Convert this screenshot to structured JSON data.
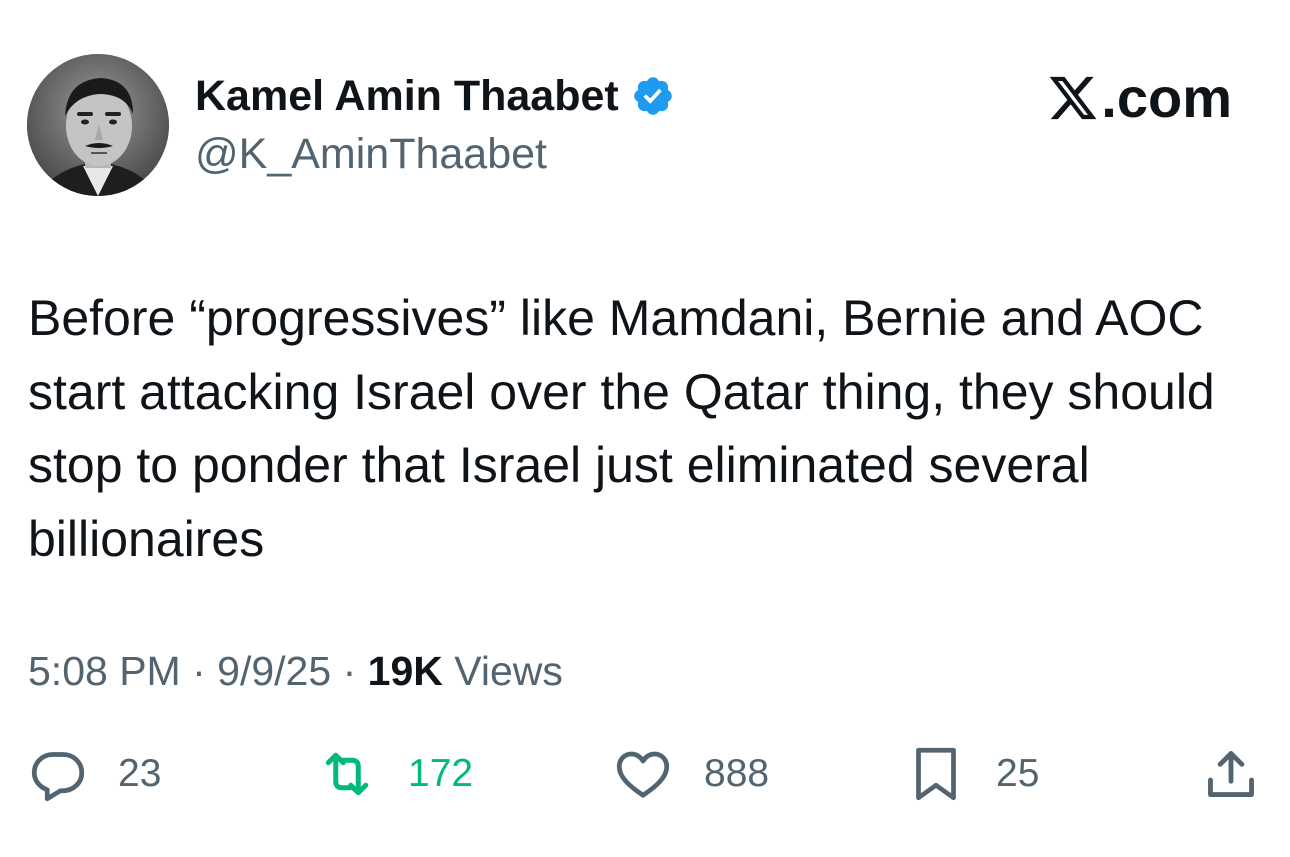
{
  "author": {
    "name": "Kamel Amin Thaabet",
    "handle": "@K_AminThaabet",
    "verified_icon": "verified-badge-icon",
    "avatar_icon": "avatar-photo"
  },
  "brand": {
    "label": ".com",
    "icon": "x-logo-icon"
  },
  "tweet": {
    "text": "Before “progressives” like Mamdani, Bernie and AOC start attacking Israel over the Qatar thing, they should stop to ponder that Israel just eliminated several billionaires"
  },
  "meta": {
    "time": "5:08 PM",
    "separator": "·",
    "date": "9/9/25",
    "views_count": "19K",
    "views_label": "Views"
  },
  "actions": {
    "replies": "23",
    "retweets": "172",
    "likes": "888",
    "bookmarks": "25"
  },
  "colors": {
    "text": "#0f1419",
    "secondary": "#536471",
    "verified": "#1d9bf0",
    "retweet_active": "#00ba7c"
  }
}
